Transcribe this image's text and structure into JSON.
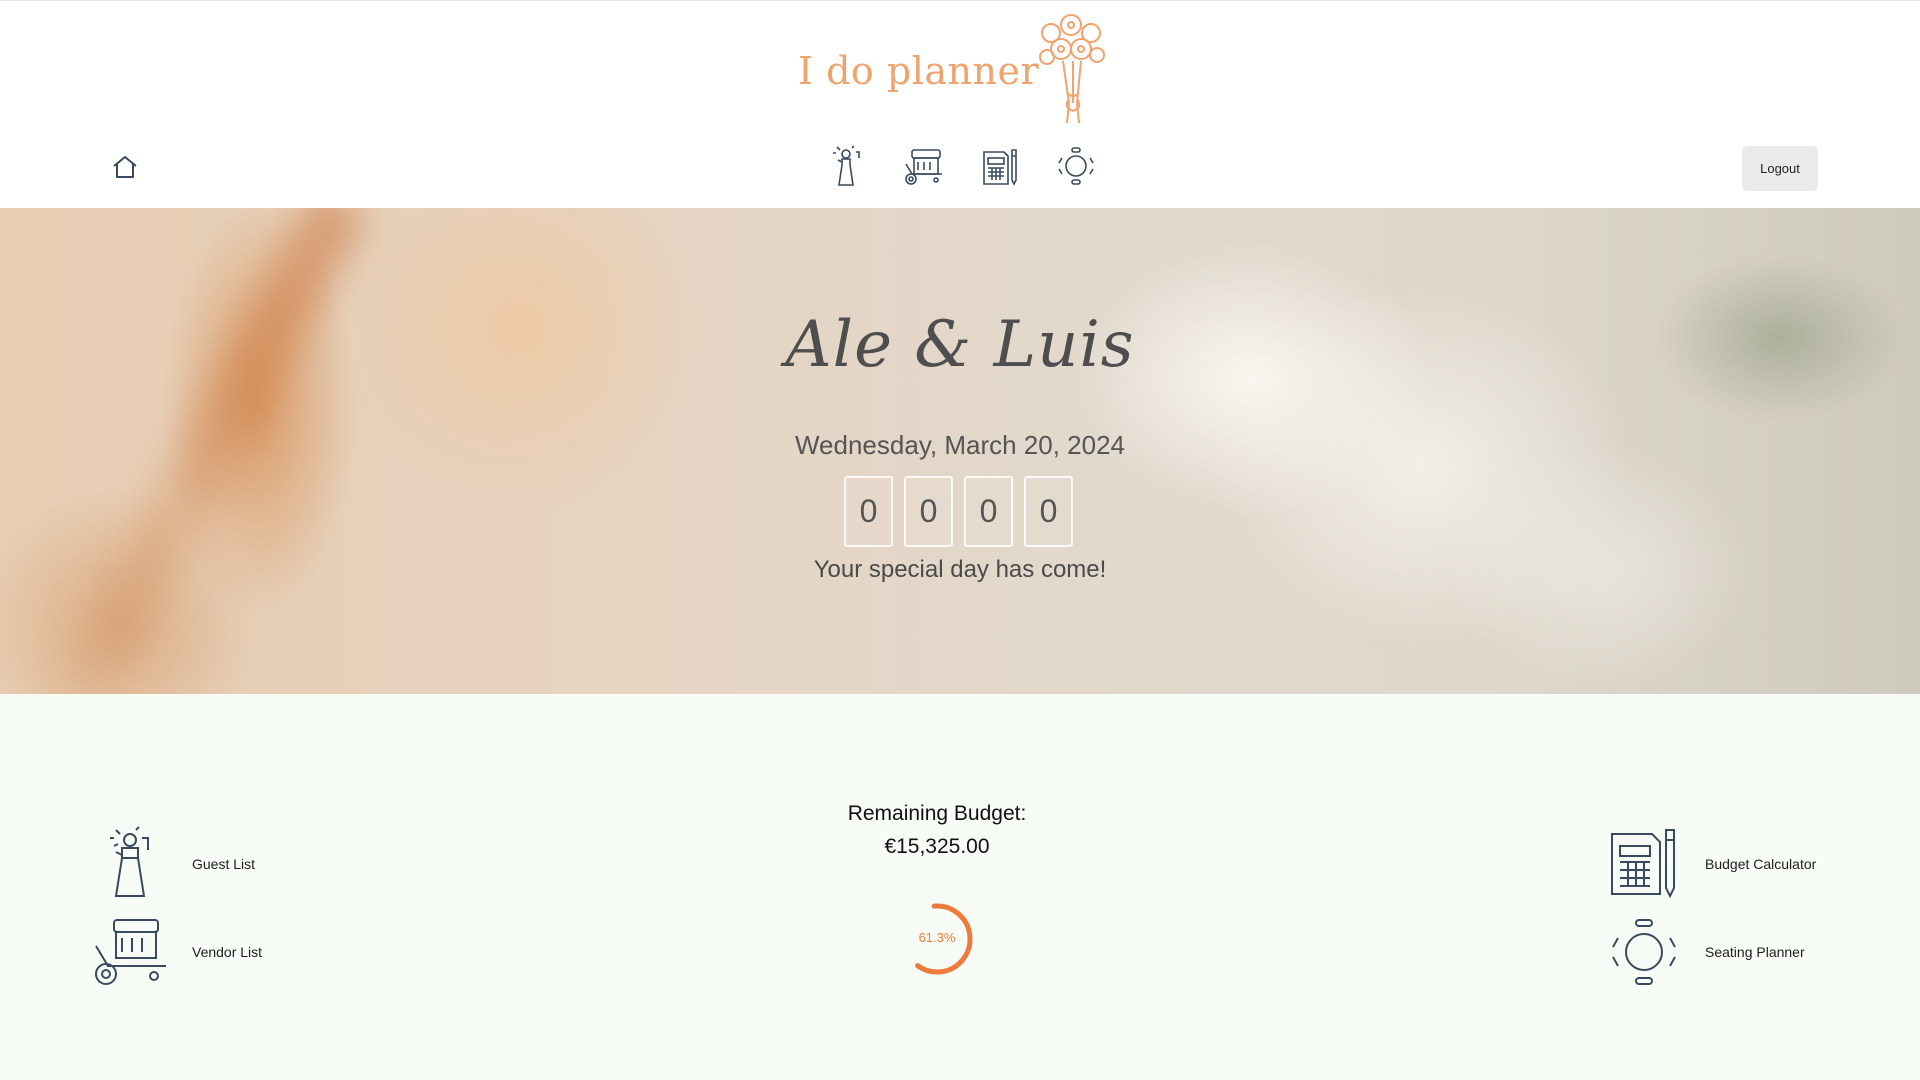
{
  "header": {
    "logo_text": "I do planner",
    "logout_label": "Logout",
    "nav_icons": [
      "guest-icon",
      "vendor-cart-icon",
      "calculator-icon",
      "seating-table-icon"
    ]
  },
  "hero": {
    "couple_names": "Ale & Luis",
    "wedding_date": "Wednesday, March 20, 2024",
    "countdown": [
      "0",
      "0",
      "0",
      "0"
    ],
    "message": "Your special day has come!"
  },
  "dashboard": {
    "quick_links": {
      "guest_list": "Guest List",
      "vendor_list": "Vendor List",
      "budget_calculator": "Budget Calculator",
      "seating_planner": "Seating Planner"
    },
    "budget": {
      "title": "Remaining Budget:",
      "amount": "€15,325.00",
      "percent_label": "61.3%",
      "percent_value": 0.613
    }
  },
  "colors": {
    "accent_orange": "#f07a3a",
    "logo_peach": "#f0a36c",
    "icon_navy": "#3a4a5e",
    "bottom_background": "#f7fcf7"
  }
}
